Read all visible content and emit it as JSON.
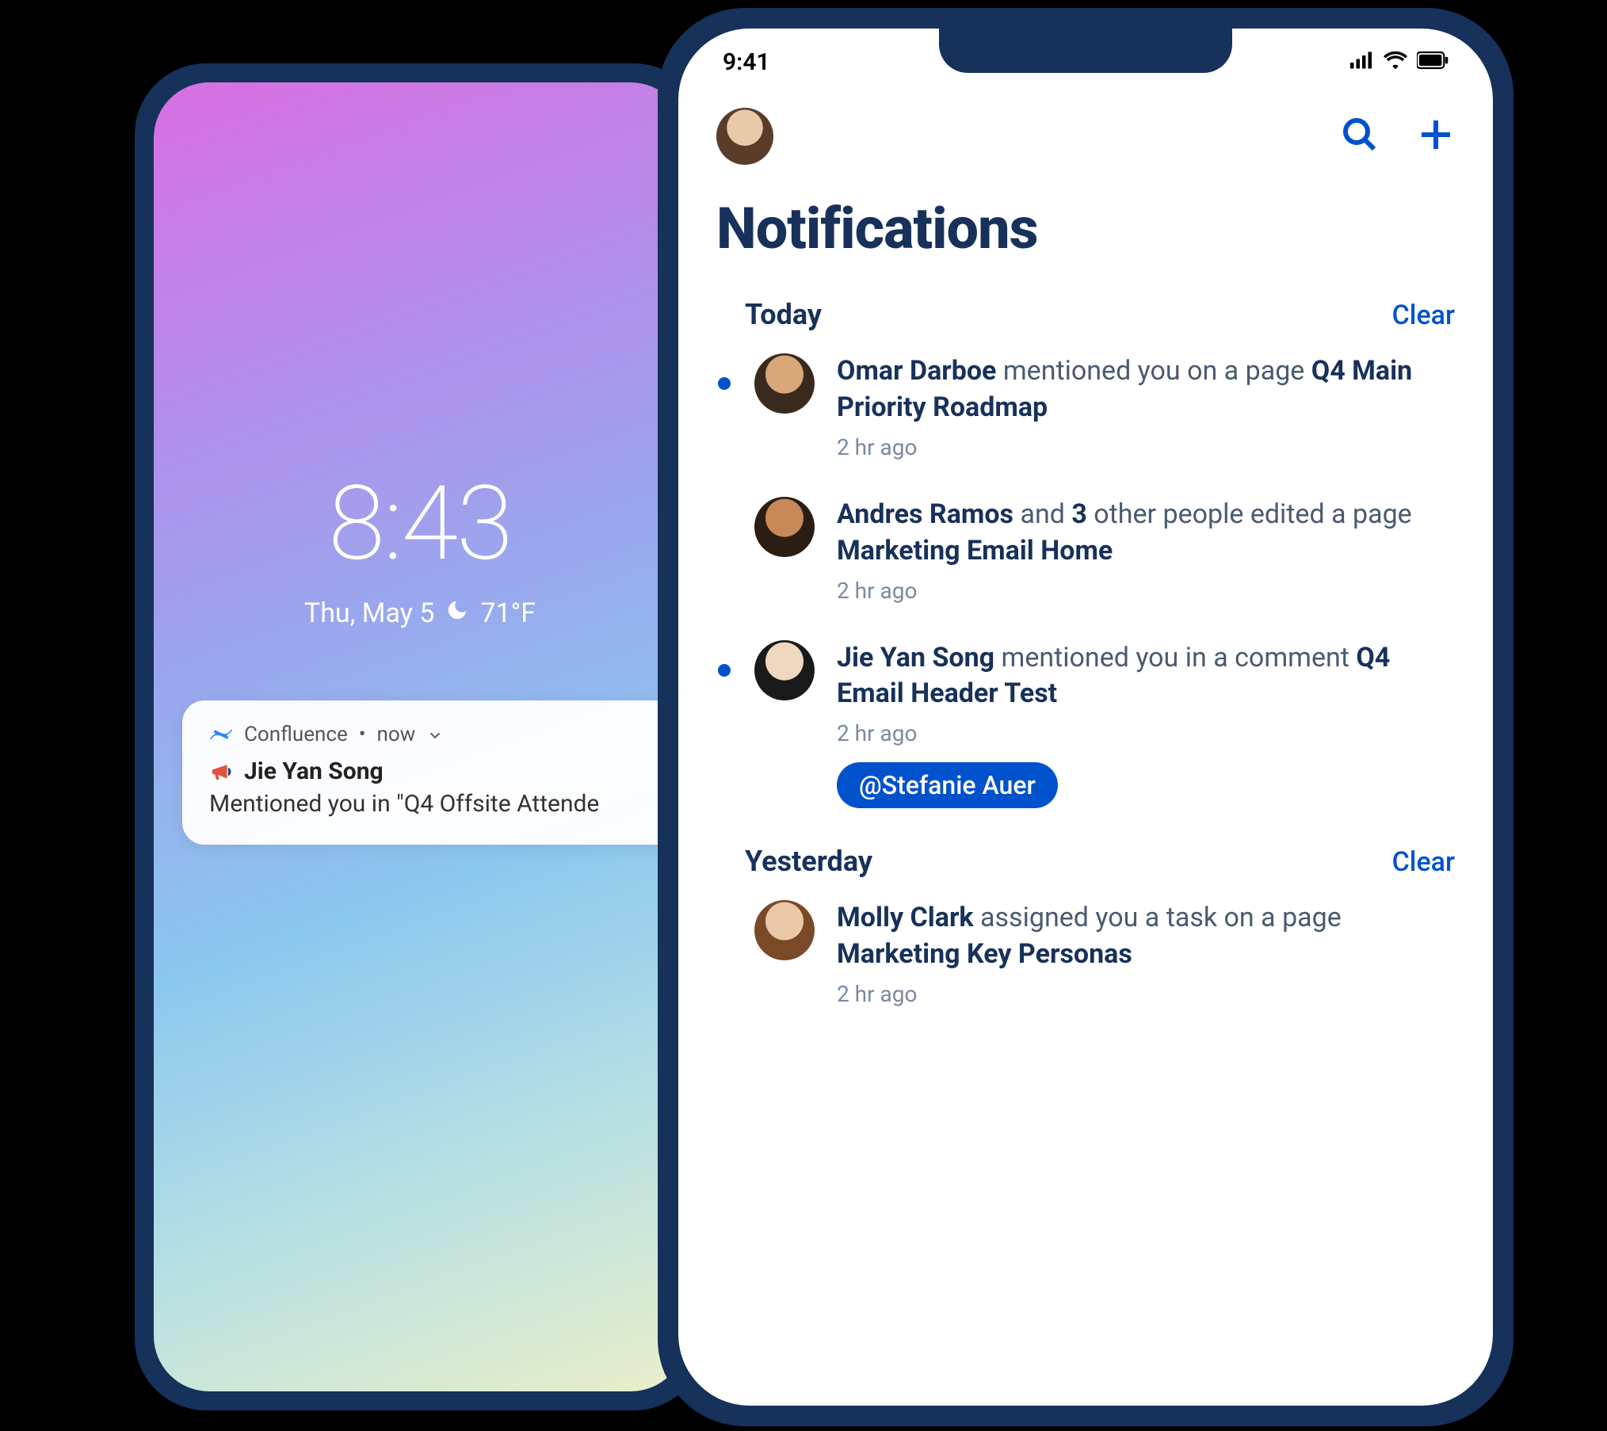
{
  "lockscreen": {
    "time": "8:43",
    "date_text": "Thu, May 5",
    "temp": "71°F",
    "notification": {
      "app": "Confluence",
      "when": "now",
      "sender": "Jie Yan Song",
      "body": "Mentioned you in \"Q4 Offsite Attende"
    }
  },
  "status": {
    "time": "9:41"
  },
  "header": {
    "title": "Notifications"
  },
  "actions": {
    "clear": "Clear"
  },
  "sections": [
    {
      "title": "Today",
      "items": [
        {
          "unread": true,
          "actor": "Omar Darboe",
          "middle": " mentioned you on a page ",
          "object": "Q4 Main Priority Roadmap",
          "time": "2 hr ago",
          "mention": null
        },
        {
          "unread": false,
          "actor": "Andres Ramos",
          "middle_pre": " and ",
          "count": "3",
          "middle_post": " other people edited a page ",
          "object": "Marketing Email Home",
          "time": "2 hr ago",
          "mention": null
        },
        {
          "unread": true,
          "actor": "Jie Yan Song",
          "middle": " mentioned you in a comment ",
          "object": "Q4 Email Header Test",
          "time": "2 hr ago",
          "mention": "@Stefanie Auer"
        }
      ]
    },
    {
      "title": "Yesterday",
      "items": [
        {
          "unread": false,
          "actor": "Molly Clark",
          "middle": " assigned you a task on a page ",
          "object": "Marketing Key Personas",
          "time": "2 hr ago",
          "mention": null
        }
      ]
    }
  ]
}
